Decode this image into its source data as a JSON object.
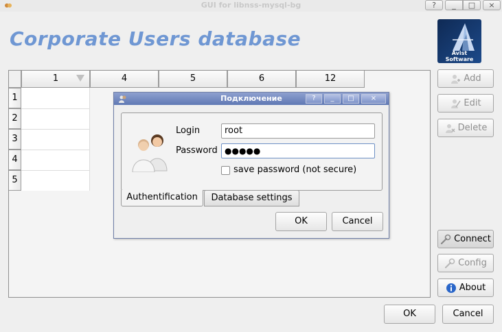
{
  "window": {
    "title": "GUI for libnss-mysql-bg",
    "controls": [
      "?",
      "_",
      "□",
      "×"
    ]
  },
  "heading": "Corporate Users database",
  "logo": {
    "text": "Avist Software"
  },
  "grid": {
    "columns": [
      "1",
      "4",
      "5",
      "6",
      "12"
    ],
    "rows": [
      "1",
      "2",
      "3",
      "4",
      "5"
    ]
  },
  "side_buttons": {
    "add": "Add",
    "edit": "Edit",
    "delete": "Delete",
    "connect": "Connect",
    "config": "Config",
    "about": "About"
  },
  "footer": {
    "ok": "OK",
    "cancel": "Cancel"
  },
  "dialog": {
    "title": "Подключение",
    "controls": [
      "?",
      "_",
      "□",
      "×"
    ],
    "login_label": "Login",
    "login_value": "root",
    "password_label": "Password",
    "password_value": "●●●●●",
    "save_password_label": "save password (not secure)",
    "save_password_checked": false,
    "tabs": [
      "Authentification",
      "Database settings"
    ],
    "active_tab": "Authentification",
    "ok": "OK",
    "cancel": "Cancel"
  },
  "colors": {
    "heading": "#6f97d3",
    "dialog_title": "#5f78b4",
    "logo": "#1d4a8a"
  }
}
